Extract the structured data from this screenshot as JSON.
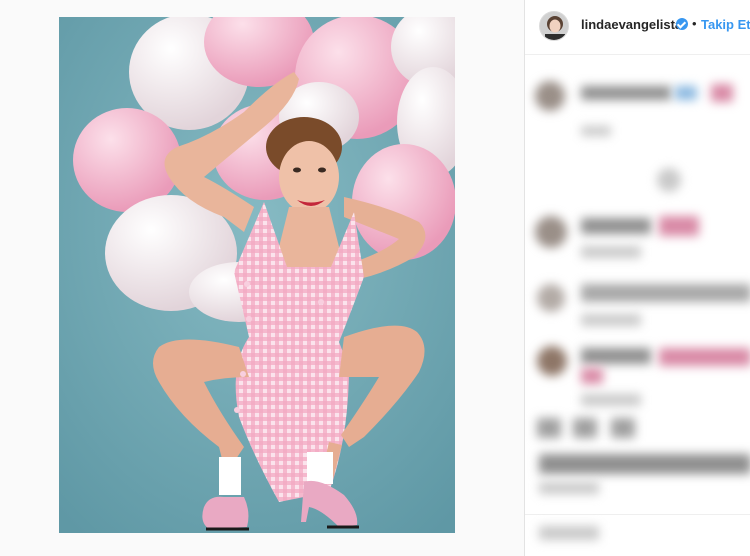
{
  "post": {
    "author": {
      "username": "lindaevangelista",
      "verified": true,
      "verified_badge_icon": "verified-badge-icon"
    },
    "separator": "•",
    "follow_label": "Takip Et"
  },
  "colors": {
    "photo_background": "#6fa6b1",
    "balloon_pink": "#f2b3c9",
    "balloon_white": "#f5eef1",
    "dress_gingham": "#f4b8cd",
    "link_blue": "#3897f0",
    "verified_blue": "#3897f0"
  }
}
